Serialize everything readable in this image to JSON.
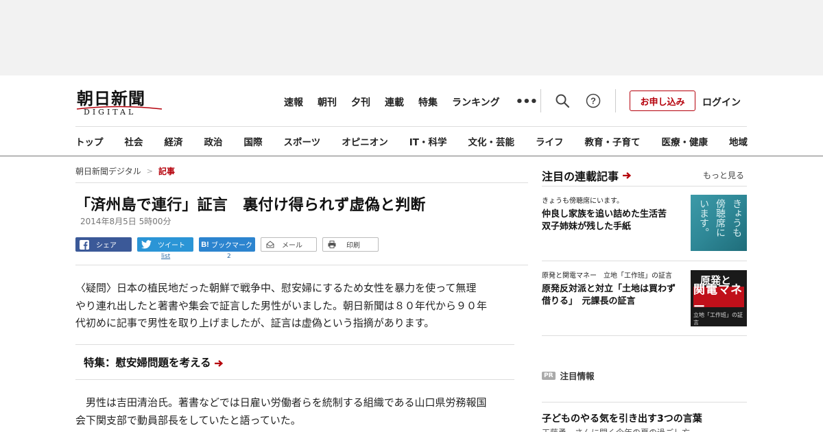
{
  "header": {
    "logo_main": "朝日新聞",
    "logo_sub": "DIGITAL",
    "gnav": [
      "速報",
      "朝刊",
      "夕刊",
      "連載",
      "特集",
      "ランキング"
    ],
    "more": "•••",
    "apply": "お申し込み",
    "login": "ログイン"
  },
  "catnav": [
    "トップ",
    "社会",
    "経済",
    "政治",
    "国際",
    "スポーツ",
    "オピニオン",
    "IT・科学",
    "文化・芸能",
    "ライフ",
    "教育・子育て",
    "医療・健康",
    "地域"
  ],
  "breadcrumb": {
    "home": "朝日新聞デジタル",
    "sep": ">",
    "current": "記事"
  },
  "article": {
    "title": "「済州島で連行」証言　裏付け得られず虚偽と判断",
    "date": "2014年8月5日 5時00分",
    "share": {
      "facebook": "シェア",
      "twitter": "ツイート",
      "hatena": "ブックマーク",
      "mail": "メール",
      "print": "印刷",
      "twitter_count": "list",
      "hatena_count": "2"
    },
    "lead_lines": [
      "〈疑問〉日本の植民地だった朝鮮で戦争中、慰安婦にするため女性を暴力を使って無理",
      "やり連れ出したと著書や集会で証言した男性がいました。朝日新聞は８０年代から９０年",
      "代初めに記事で男性を取り上げましたが、証言は虚偽という指摘があります。"
    ],
    "feature_link": "特集：慰安婦問題を考える",
    "body_lines": [
      "　男性は吉田清治氏。著書などでは日雇い労働者らを統制する組織である山口県労務報国",
      "会下関支部で動員部長をしていたと語っていた。"
    ]
  },
  "sidebar": {
    "head": "注目の連載記事",
    "more": "もっと見る",
    "items": [
      {
        "kicker": "きょうも傍聴席にいます。",
        "title_lines": [
          "仲良し家族を追い詰めた生活苦",
          "双子姉妹が残した手紙"
        ],
        "thumb_cols": [
          "きょうも",
          "傍聴席に",
          "います。"
        ]
      },
      {
        "kicker": "原発と関電マネー　立地「工作班」の証言",
        "title_lines": [
          "原発反対派と対立「土地は買わず",
          "借りる」　元課長の証言"
        ],
        "thumb_top": "原発と",
        "thumb_mid": "関電マネー",
        "thumb_bottom": "立地「工作班」の証言"
      }
    ],
    "pr_badge": "PR",
    "pr_label": "注目情報",
    "pr_title": "子どものやる気を引き出す3つの言葉",
    "pr_sub": "工藤勇一さんに聞く今年の夏の過ごし方"
  },
  "colors": {
    "brand_red": "#b5000b",
    "facebook": "#3b5998",
    "twitter": "#2b95d6",
    "hatena": "#2c84cf"
  }
}
